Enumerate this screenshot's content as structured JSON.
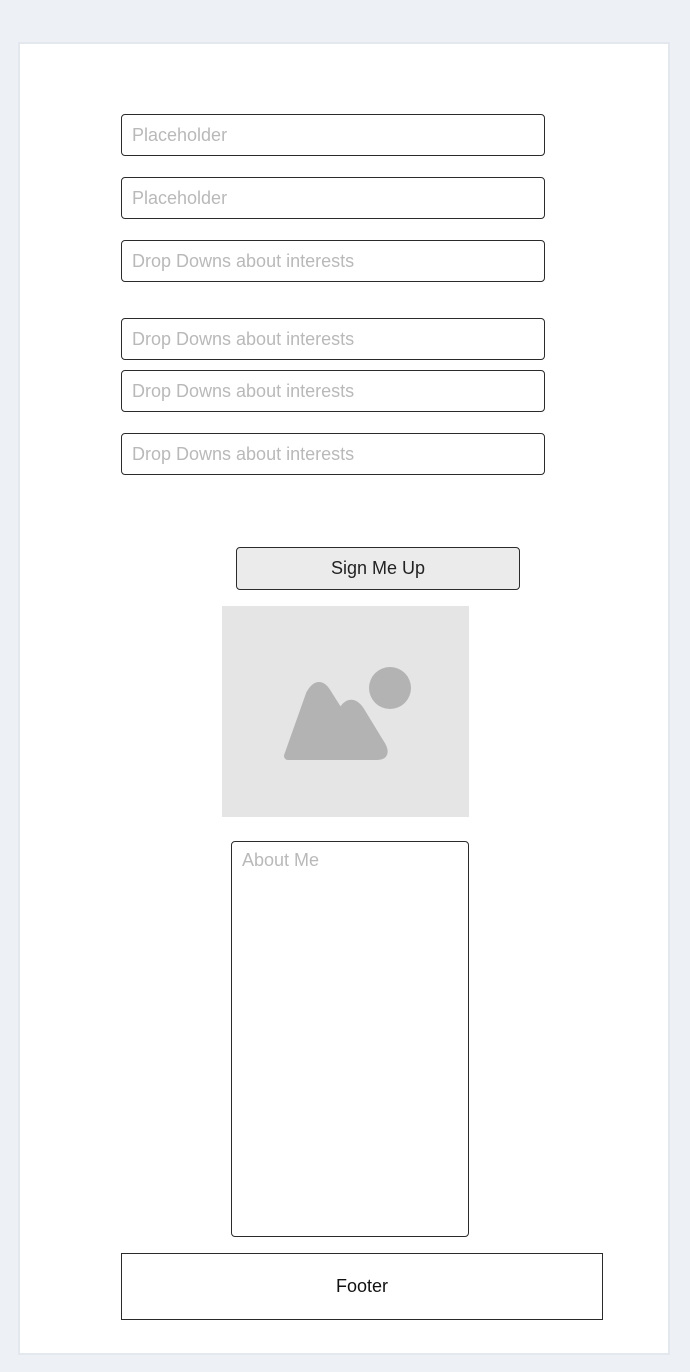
{
  "form": {
    "fields": [
      {
        "placeholder": "Placeholder",
        "value": ""
      },
      {
        "placeholder": "Placeholder",
        "value": ""
      },
      {
        "placeholder": "Drop Downs about interests",
        "value": ""
      },
      {
        "placeholder": "Drop Downs about interests",
        "value": ""
      },
      {
        "placeholder": "Drop Downs about interests",
        "value": ""
      },
      {
        "placeholder": "Drop Downs about interests",
        "value": ""
      }
    ],
    "submit_label": "Sign Me Up",
    "image_icon": "image-placeholder-icon",
    "about": {
      "placeholder": "About Me",
      "value": ""
    }
  },
  "footer": {
    "label": "Footer"
  },
  "colors": {
    "page_background": "#edf0f5",
    "card_background": "#ffffff",
    "border": "#2b2b2b",
    "placeholder_text": "#b9b9b9",
    "button_background": "#ebebeb",
    "image_background": "#e5e5e5",
    "image_icon": "#b3b3b3"
  }
}
